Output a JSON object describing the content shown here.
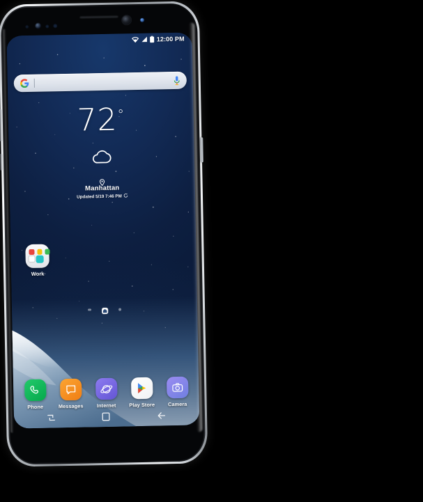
{
  "device": {
    "name": "Samsung Galaxy S8",
    "color": "Arctic Silver",
    "hardware": {
      "earpiece": "earpiece-speaker",
      "iris_scanner": "iris-scanner-sensor",
      "front_camera": "front-camera",
      "status_led": "status-led",
      "power_button": "power-button",
      "volume_button": "volume-button",
      "bixby_button": "bixby-button"
    }
  },
  "statusbar": {
    "wifi_icon": "wifi-icon",
    "signal_icon": "cellular-signal-icon",
    "battery_icon": "battery-icon",
    "time": "12:00 PM"
  },
  "search": {
    "placeholder": "",
    "value": "",
    "google_icon": "google-g-icon",
    "mic_icon": "microphone-icon"
  },
  "weather": {
    "temperature": "72",
    "degree_symbol": "°",
    "condition_icon": "cloudy-icon",
    "location_pin_icon": "location-pin-icon",
    "city": "Manhattan",
    "updated": "Updated 5/19 7:46 PM",
    "refresh_icon": "refresh-icon"
  },
  "folder": {
    "label": "Work",
    "apps": [
      {
        "name": "gmail-mini-icon",
        "color": "#e8453c"
      },
      {
        "name": "chrome-mini-icon",
        "color": "#f4c20d"
      },
      {
        "name": "drive-mini-icon",
        "color": "#3cba54"
      },
      {
        "name": "play-mini-icon",
        "color": "#ffffff"
      },
      {
        "name": "calendar-mini-icon",
        "color": "#27c4c4"
      }
    ]
  },
  "page_indicator": {
    "home_icon": "home-page-icon",
    "dots": 2,
    "active_index": 1
  },
  "dock": {
    "apps": [
      {
        "label": "Phone",
        "icon": "phone-icon",
        "color": "#14ba5c"
      },
      {
        "label": "Messages",
        "icon": "messages-icon",
        "color": "#f59121"
      },
      {
        "label": "Internet",
        "icon": "internet-icon",
        "color": "#7b6ae0"
      },
      {
        "label": "Play Store",
        "icon": "play-store-icon",
        "color": "#ffffff"
      },
      {
        "label": "Camera",
        "icon": "camera-icon",
        "color": "#8b7be8"
      }
    ]
  },
  "navbar": {
    "recents_icon": "recents-icon",
    "home_icon": "home-icon",
    "back_icon": "back-icon"
  },
  "theme": {
    "wallpaper_top": "#122a55",
    "wallpaper_bottom": "#9fb4c8",
    "text_on_wallpaper": "#ffffff"
  }
}
